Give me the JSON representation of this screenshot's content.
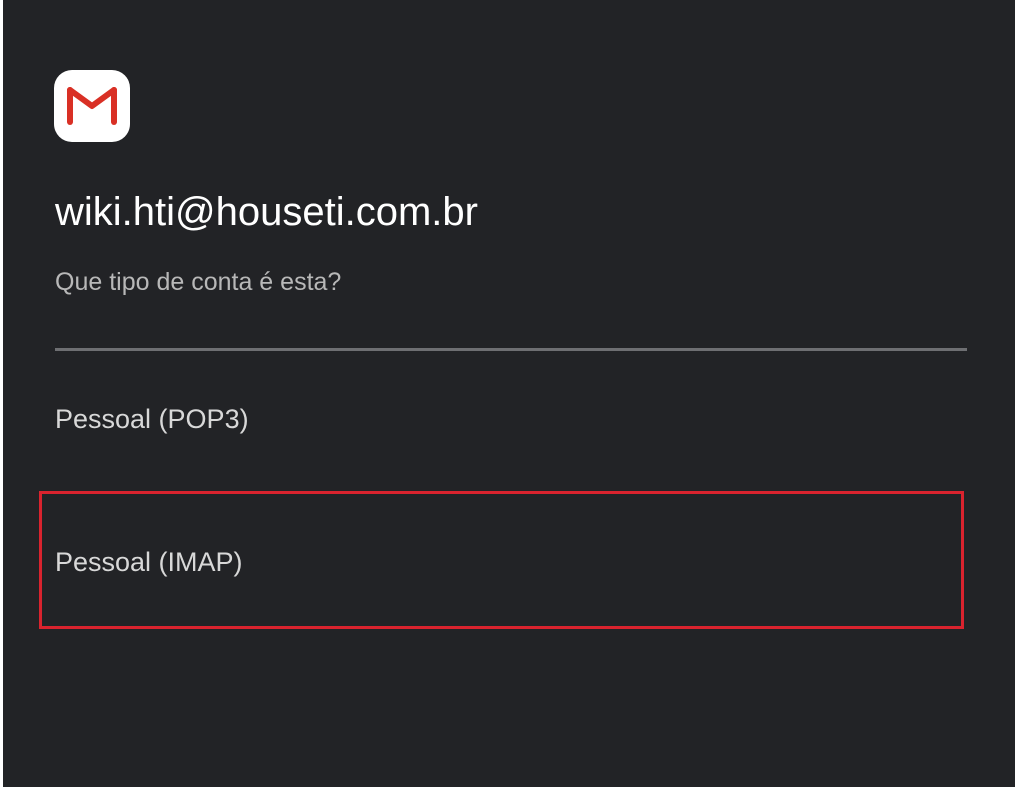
{
  "app": {
    "icon": "gmail-icon"
  },
  "account": {
    "email": "wiki.hti@houseti.com.br",
    "question": "Que tipo de conta é esta?"
  },
  "options": [
    {
      "label": "Pessoal (POP3)"
    },
    {
      "label": "Pessoal (IMAP)",
      "highlighted": true
    }
  ],
  "colors": {
    "background": "#222326",
    "highlight_border": "#d9232e",
    "gmail_red": "#d93025",
    "divider": "#6e6f72"
  }
}
